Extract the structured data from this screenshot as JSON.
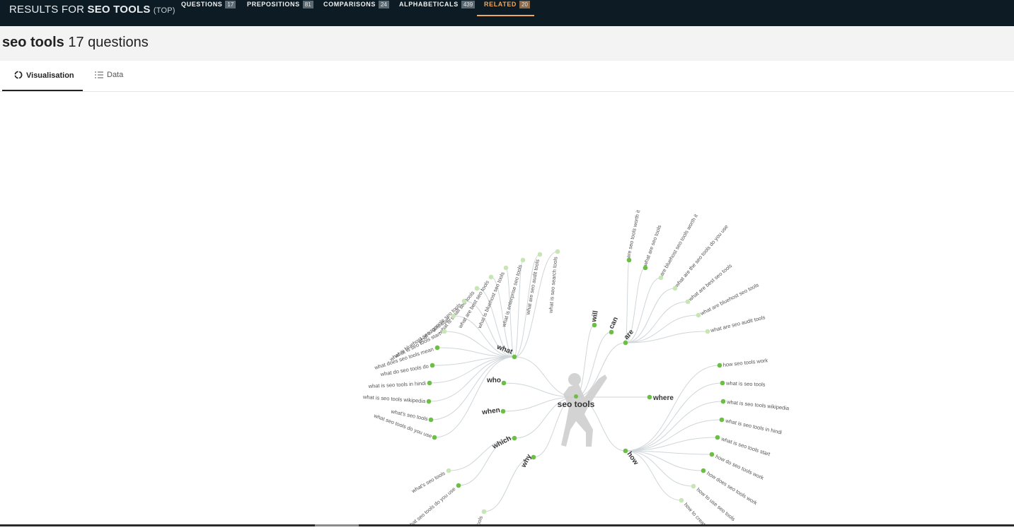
{
  "header": {
    "results_prefix": "RESULTS FOR",
    "keyword": "SEO TOOLS",
    "scope": "(TOP)",
    "nav": [
      {
        "label": "QUESTIONS",
        "count": "17"
      },
      {
        "label": "PREPOSITIONS",
        "count": "81"
      },
      {
        "label": "COMPARISONS",
        "count": "24"
      },
      {
        "label": "ALPHABETICALS",
        "count": "439"
      },
      {
        "label": "RELATED",
        "count": "20"
      }
    ]
  },
  "page": {
    "keyword": "seo tools",
    "count_text": "17 questions"
  },
  "tabs": {
    "visualisation": "Visualisation",
    "data": "Data"
  },
  "colors": {
    "header_bg": "#0c1b24",
    "active_nav": "#f0a85a",
    "node_dark": "#6cbf45",
    "node_light": "#c8e6b5",
    "link": "#cfd6da"
  },
  "graph": {
    "center": "seo tools",
    "branches": [
      {
        "label": "what",
        "children": [
          "what is seo search tools",
          "what are seo audit tools",
          "what is enterprise seo tools",
          "what is bluehost seo tools",
          "what are best seo tools",
          "what is small seo tools",
          "what is google seo tools",
          "what is bluehost seo tools start",
          "what is seo tools start",
          "what does seo tools mean",
          "what do seo tools do",
          "what is seo tools in hindi",
          "what is seo tools wikipedia",
          "what's seo tools",
          "what seo tools do you use"
        ]
      },
      {
        "label": "who",
        "children": []
      },
      {
        "label": "when",
        "children": []
      },
      {
        "label": "which",
        "children": [
          "what's seo tools",
          "what seo tools do you use"
        ]
      },
      {
        "label": "why",
        "children": [
          "tools"
        ]
      },
      {
        "label": "will",
        "children": []
      },
      {
        "label": "can",
        "children": []
      },
      {
        "label": "are",
        "children": [
          "are seo tools worth it",
          "what are seo tools",
          "are bluehost seo tools worth it",
          "what are the seo tools do you use",
          "what are best seo tools",
          "what are bluehost seo tools",
          "what are seo audit tools"
        ]
      },
      {
        "label": "where",
        "children": []
      },
      {
        "label": "how",
        "children": [
          "how seo tools work",
          "what is seo tools",
          "what is seo tools wikipedia",
          "what is seo tools in hindi",
          "what is seo tools start",
          "how do seo tools work",
          "how does seo tools work",
          "how to use seo tools",
          "how to create"
        ]
      }
    ]
  }
}
